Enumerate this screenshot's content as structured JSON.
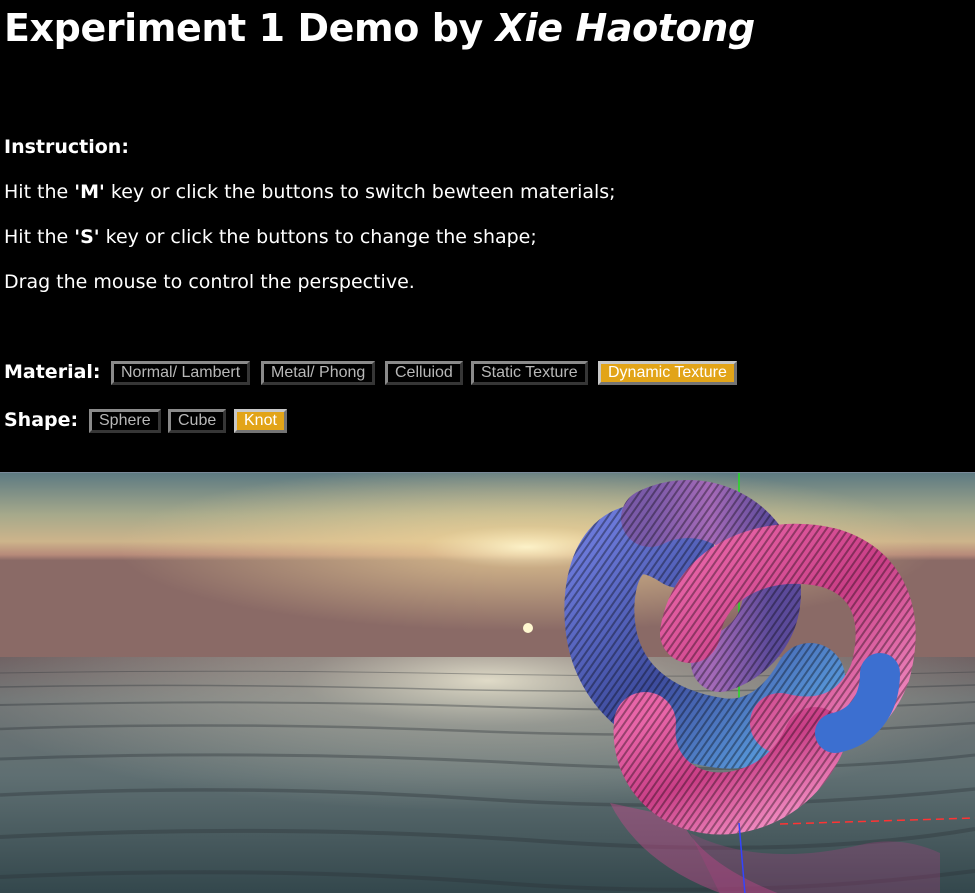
{
  "header": {
    "title_prefix": "Experiment 1 Demo by ",
    "title_author": "Xie Haotong"
  },
  "instructions": {
    "label": "Instruction:",
    "line1": {
      "pre": "Hit the ",
      "key": "'M'",
      "post": " key or click the buttons to switch bewteen materials;"
    },
    "line2": {
      "pre": "Hit the ",
      "key": "'S'",
      "post": " key or click the buttons to change the shape;"
    },
    "line3": "Drag the mouse to control the perspective."
  },
  "material": {
    "label": "Material:",
    "options": [
      "Normal/ Lambert",
      "Metal/ Phong",
      "Celluiod",
      "Static Texture",
      "Dynamic Texture"
    ],
    "selected": "Dynamic Texture"
  },
  "shape": {
    "label": "Shape:",
    "options": [
      "Sphere",
      "Cube",
      "Knot"
    ],
    "selected": "Knot"
  },
  "colors": {
    "active_button": "#e2a418",
    "background": "#000000",
    "y_axis": "#22dd22",
    "x_axis": "#ff3333",
    "z_axis": "#3344ff"
  },
  "scene": {
    "object": "knot",
    "background": "sunset-over-ocean"
  }
}
